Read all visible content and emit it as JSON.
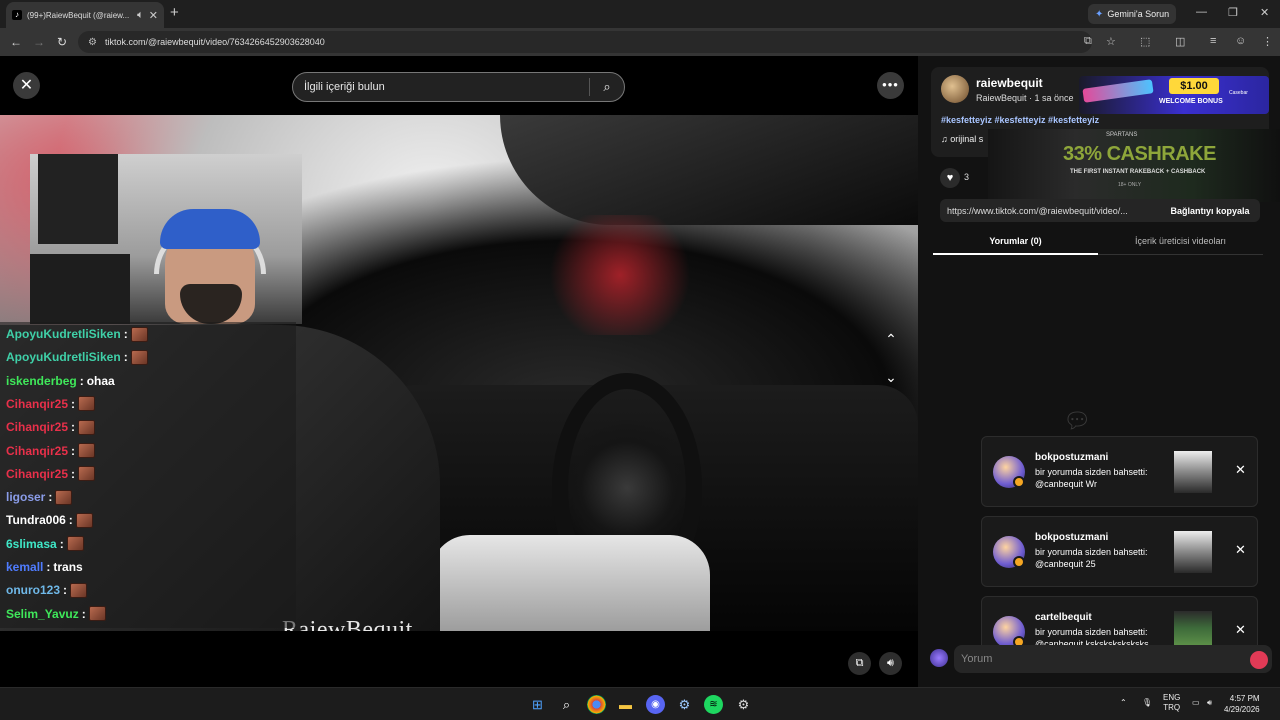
{
  "browser": {
    "tab_title": "(99+)RaiewBequit (@raiew...",
    "tab_favicon": "tiktok-icon",
    "new_tab": "+",
    "gemini_label": "Gemini'a Sorun",
    "url": "tiktok.com/@raiewbequit/video/7634266452903628040"
  },
  "video_page": {
    "search_placeholder": "İlgili içeriği bulun",
    "watermark": "RaiewBequit"
  },
  "chat": [
    {
      "user": "ApoyuKudretliSiken",
      "color": "#3fd0a8",
      "msg": "",
      "emote": true
    },
    {
      "user": "ApoyuKudretliSiken",
      "color": "#3fd0a8",
      "msg": "",
      "emote": true
    },
    {
      "user": "iskenderbeg",
      "color": "#3fe85a",
      "msg": "ohaa",
      "emote": false
    },
    {
      "user": "Cihanqir25",
      "color": "#e8304a",
      "msg": "",
      "emote": true
    },
    {
      "user": "Cihanqir25",
      "color": "#e8304a",
      "msg": "",
      "emote": true
    },
    {
      "user": "Cihanqir25",
      "color": "#e8304a",
      "msg": "",
      "emote": true
    },
    {
      "user": "Cihanqir25",
      "color": "#e8304a",
      "msg": "",
      "emote": true
    },
    {
      "user": "ligoser",
      "color": "#8a9ce8",
      "msg": "",
      "emote": true
    },
    {
      "user": "Tundra006",
      "color": "#ffffff",
      "msg": "",
      "emote": true
    },
    {
      "user": "6slimasa",
      "color": "#3fe8c8",
      "msg": "",
      "emote": true
    },
    {
      "user": "kemall",
      "color": "#4f7cff",
      "msg": "trans",
      "emote": false
    },
    {
      "user": "onuro123",
      "color": "#6fb8e8",
      "msg": "",
      "emote": true
    },
    {
      "user": "Selim_Yavuz",
      "color": "#3fe85a",
      "msg": "",
      "emote": true
    }
  ],
  "panel": {
    "username": "raiewbequit",
    "subline": "RaiewBequit · 1 sa önce",
    "tags": "#kesfetteyiz #kesfetteyiz #kesfetteyiz",
    "sound": "♫  orijinal s",
    "ad1_price": "$1.00",
    "ad1_text": "WELCOME BONUS",
    "ad1_brand": "Casebar",
    "ad2_top": "SPARTANS",
    "ad2_big": "33% CASHRAKE",
    "ad2_sub": "THE FIRST INSTANT RAKEBACK + CASHBACK",
    "ad2_small": "18+ ONLY",
    "like_count": "3",
    "link_url": "https://www.tiktok.com/@raiewbequit/video/...",
    "copy_link": "Bağlantıyı kopyala",
    "tab_comments": "Yorumlar (0)",
    "tab_creator": "İçerik üreticisi videoları",
    "comment_placeholder": "Yorum"
  },
  "notifications": [
    {
      "user": "bokpostuzmani",
      "msg": "bir yorumda sizden bahsetti: @canbequit Wr",
      "thumb": "video-thumb"
    },
    {
      "user": "bokpostuzmani",
      "msg": "bir yorumda sizden bahsetti: @canbequit 25",
      "thumb": "video-thumb"
    },
    {
      "user": "cartelbequit",
      "msg": "bir yorumda sizden bahsetti: @canbequit ksksksksksksks",
      "thumb": "field-thumb"
    }
  ],
  "taskbar": {
    "lang_top": "ENG",
    "lang_bottom": "TRQ",
    "time": "4:57 PM",
    "date": "4/29/2026"
  }
}
